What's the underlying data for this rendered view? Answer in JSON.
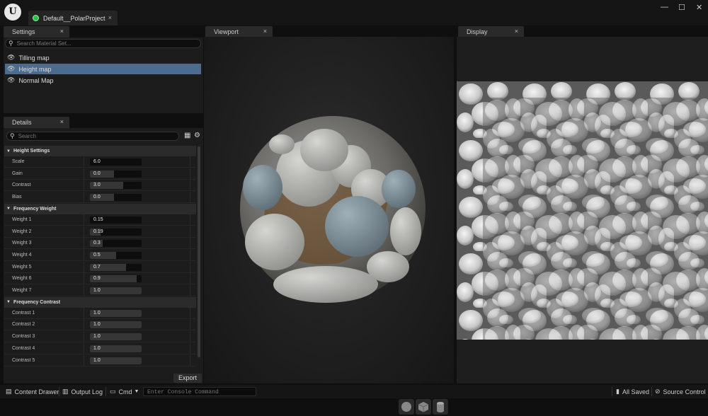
{
  "window": {
    "logo": "U",
    "project_tab": "Default__PolarProject",
    "close_glyph": "×",
    "controls": {
      "minimize": "—",
      "maximize": "☐",
      "close": "✕"
    }
  },
  "settings": {
    "tab_label": "Settings",
    "search_placeholder": "Search Material Set...",
    "items": [
      {
        "label": "Tilling map",
        "selected": false
      },
      {
        "label": "Height map",
        "selected": true
      },
      {
        "label": "Normal Map",
        "selected": false
      }
    ]
  },
  "details": {
    "tab_label": "Details",
    "search_placeholder": "Search",
    "sections": [
      {
        "title": "Height Settings",
        "props": [
          {
            "label": "Scale",
            "value": "6.0",
            "fill": 0.0
          },
          {
            "label": "Gain",
            "value": "0.0",
            "fill": 0.47
          },
          {
            "label": "Contrast",
            "value": "3.0",
            "fill": 0.65
          },
          {
            "label": "Bias",
            "value": "0.0",
            "fill": 0.47
          }
        ]
      },
      {
        "title": "Frequency Weight",
        "props": [
          {
            "label": "Weight 1",
            "value": "0.15",
            "fill": 0.0
          },
          {
            "label": "Weight 2",
            "value": "0.19",
            "fill": 0.2
          },
          {
            "label": "Weight 3",
            "value": "0.3",
            "fill": 0.25
          },
          {
            "label": "Weight 4",
            "value": "0.5",
            "fill": 0.5
          },
          {
            "label": "Weight 5",
            "value": "0.7",
            "fill": 0.7
          },
          {
            "label": "Weight 6",
            "value": "0.9",
            "fill": 0.9
          },
          {
            "label": "Weight 7",
            "value": "1.0",
            "fill": 1.0
          }
        ]
      },
      {
        "title": "Frequency Contrast",
        "props": [
          {
            "label": "Contrast 1",
            "value": "1.0",
            "fill": 1.0
          },
          {
            "label": "Contrast 2",
            "value": "1.0",
            "fill": 1.0
          },
          {
            "label": "Contrast 3",
            "value": "1.0",
            "fill": 1.0
          },
          {
            "label": "Contrast 4",
            "value": "1.0",
            "fill": 1.0
          },
          {
            "label": "Contrast 5",
            "value": "1.0",
            "fill": 1.0
          }
        ]
      }
    ],
    "export_label": "Export"
  },
  "viewport": {
    "tab_label": "Viewport",
    "preview_buttons": [
      "sphere-icon",
      "cube-icon",
      "cylinder-icon"
    ]
  },
  "display": {
    "tab_label": "Display"
  },
  "statusbar": {
    "content_drawer": "Content Drawer",
    "output_log": "Output Log",
    "cmd": "Cmd",
    "console_placeholder": "Enter Console Command",
    "all_saved": "All Saved",
    "source_control": "Source Control"
  },
  "colors": {
    "accent_selected": "#4d6b8c",
    "status_green": "#27c24c"
  }
}
